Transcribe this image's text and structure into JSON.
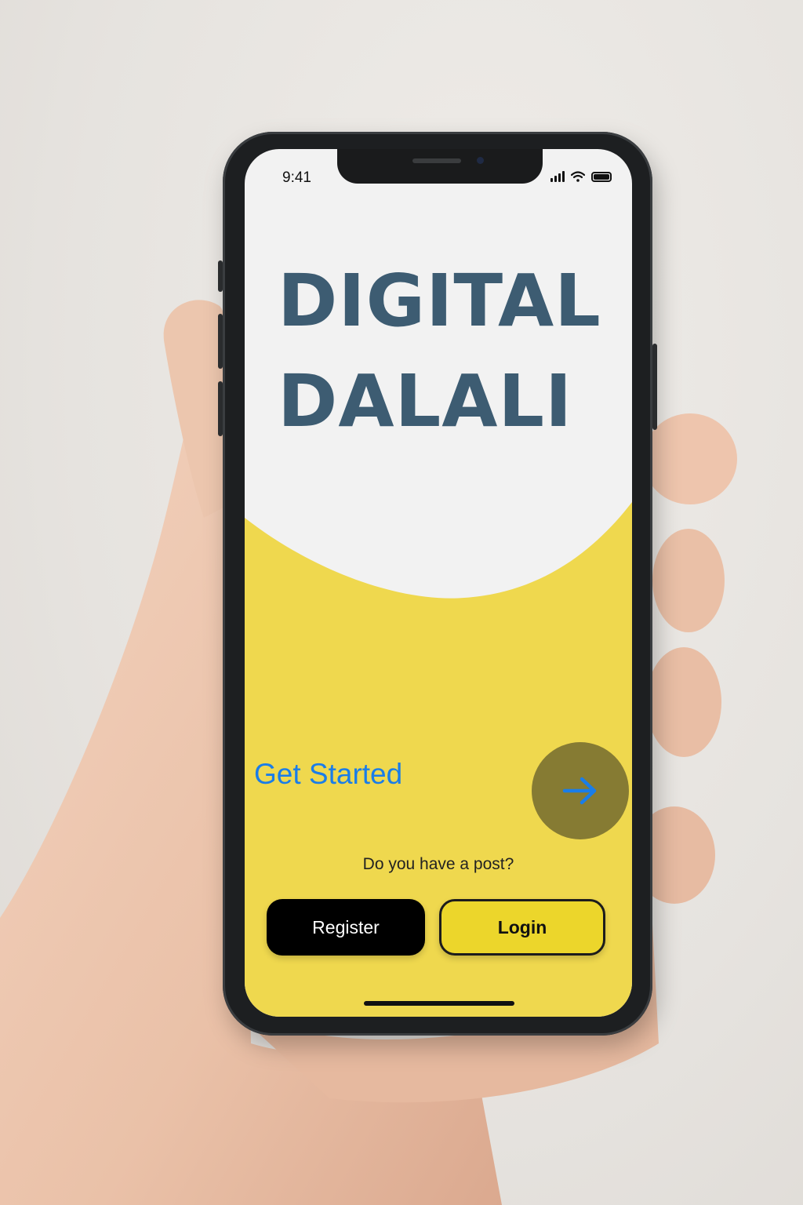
{
  "status_bar": {
    "time": "9:41"
  },
  "hero": {
    "line1": "DIGITAL",
    "line2": "DALALI"
  },
  "cta": {
    "get_started": "Get Started",
    "arrow_icon": "arrow-right-icon"
  },
  "prompt": {
    "question": "Do you have a post?"
  },
  "actions": {
    "register_label": "Register",
    "login_label": "Login"
  },
  "colors": {
    "title": "#3d5c72",
    "yellow": "#efd84e",
    "link": "#1a7de8",
    "circle": "#867b33",
    "login_bg": "#ecd62b",
    "register_bg": "#000000"
  }
}
